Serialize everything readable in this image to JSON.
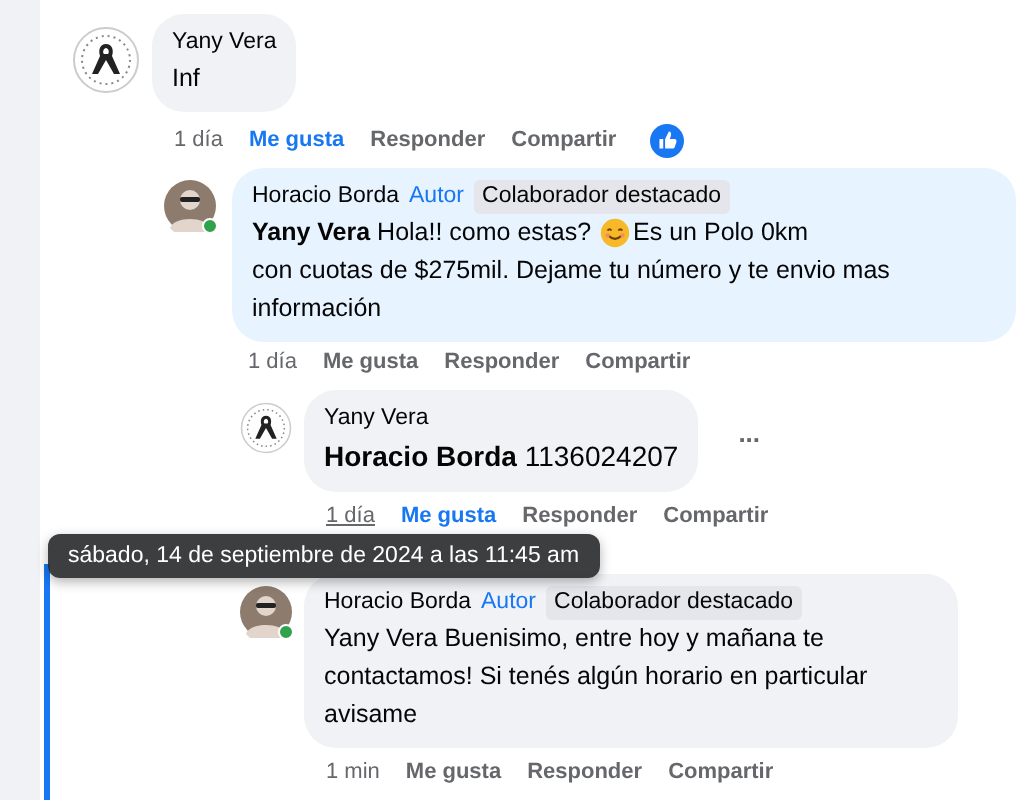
{
  "comments": [
    {
      "kind": "ribbon",
      "online": false,
      "highlighted": false,
      "focused": false,
      "author": "Yany Vera",
      "text_lines": [
        "Inf"
      ],
      "time": "1 día",
      "time_hovered": false,
      "liked": true,
      "reacted": true,
      "actions": [
        "Me gusta",
        "Responder",
        "Compartir"
      ],
      "children": [
        {
          "kind": "person",
          "online": true,
          "highlighted": true,
          "focused": false,
          "author": "Horacio Borda",
          "badges": [
            {
              "kind": "role",
              "text": "Autor"
            },
            {
              "kind": "badge",
              "text": "Colaborador destacado"
            }
          ],
          "text_lines": [
            "**Yany Vera** Hola!! como estas?",
            "Es un Polo 0km",
            "con cuotas de $275mil. Dejame tu número y te envio mas información"
          ],
          "time": "1 día",
          "time_hovered": false,
          "liked": false,
          "reacted": false,
          "actions": [
            "Me gusta",
            "Responder",
            "Compartir"
          ],
          "children": [
            {
              "kind": "ribbon",
              "online": false,
              "highlighted": false,
              "focused": false,
              "author": "Yany Vera",
              "text_lines": [
                "**Horacio Borda** 1136024207"
              ],
              "time": "1 día",
              "time_hovered": true,
              "liked": true,
              "reacted": false,
              "more_label": "...",
              "actions": [
                "Me gusta",
                "Responder",
                "Compartir"
              ]
            },
            {
              "kind": "person",
              "online": true,
              "highlighted": false,
              "focused": true,
              "author": "Horacio Borda",
              "badges": [
                {
                  "kind": "role",
                  "text": "Autor"
                },
                {
                  "kind": "badge",
                  "text": "Colaborador destacado"
                }
              ],
              "text_lines": [
                "Yany Vera Buenisimo, entre hoy y mañana te contactamos! Si tenés algún horario en particular avisame"
              ],
              "time": "1 min",
              "time_hovered": false,
              "liked": false,
              "reacted": false,
              "actions": [
                "Me gusta",
                "Responder",
                "Compartir"
              ]
            }
          ]
        }
      ]
    }
  ],
  "tooltip": {
    "text": "sábado, 14 de septiembre de 2024 a las 11:45 am"
  }
}
